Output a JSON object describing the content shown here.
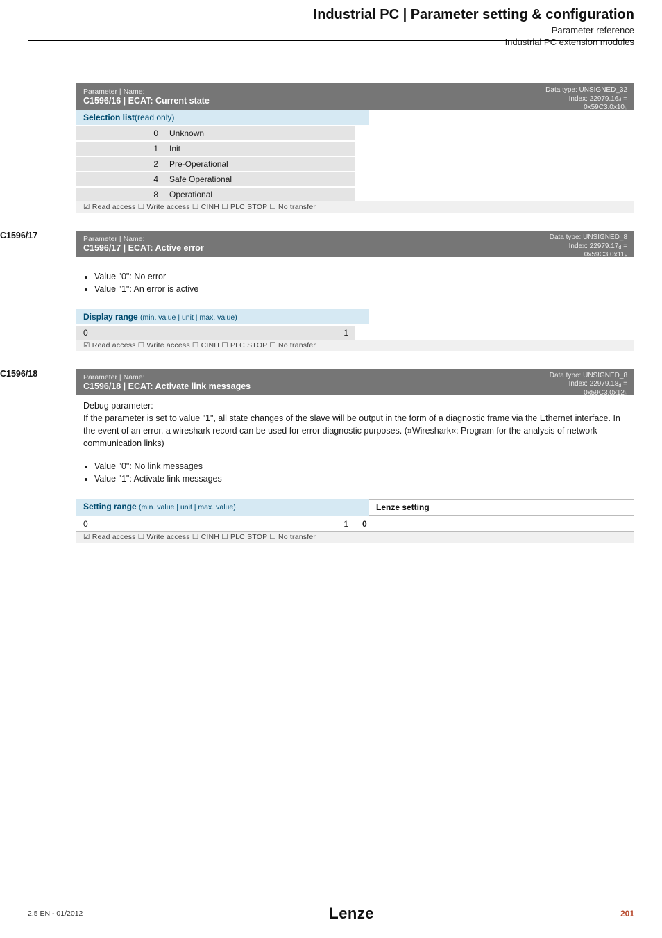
{
  "header": {
    "title": "Industrial PC | Parameter setting & configuration",
    "sub1": "Parameter reference",
    "sub2": "Industrial PC extension modules"
  },
  "labels": {
    "pn": "Parameter | Name:",
    "sel_list": "Selection list",
    "read_only": "(read only)",
    "display_range": "Display range",
    "setting_range": "Setting range",
    "range_suffix": "(min. value | unit | max. value)",
    "lenze_setting": "Lenze setting",
    "access": "☑ Read access  ☐ Write access  ☐ CINH  ☐ PLC STOP  ☐ No transfer"
  },
  "p1": {
    "name": "C1596/16 | ECAT: Current state",
    "dt1": "Data type: UNSIGNED_32",
    "dt2": "Index: 22979.16",
    "dt2sub": "d",
    "dt2eq": " =",
    "dt3": "0x59C3.0x10",
    "dt3sub": "h",
    "rows": [
      {
        "n": "0",
        "t": "Unknown"
      },
      {
        "n": "1",
        "t": "Init"
      },
      {
        "n": "2",
        "t": "Pre-Operational"
      },
      {
        "n": "4",
        "t": "Safe Operational"
      },
      {
        "n": "8",
        "t": "Operational"
      }
    ]
  },
  "p2": {
    "label": "C1596/17",
    "name": "C1596/17 | ECAT: Active error",
    "dt1": "Data type: UNSIGNED_8",
    "dt2": "Index: 22979.17",
    "dt2sub": "d",
    "dt2eq": " =",
    "dt3": "0x59C3.0x11",
    "dt3sub": "h",
    "bullets": [
      "Value \"0\": No error",
      "Value \"1\": An error is active"
    ],
    "range_min": "0",
    "range_max": "1"
  },
  "p3": {
    "label": "C1596/18",
    "name": "C1596/18 | ECAT: Activate link messages",
    "dt1": "Data type: UNSIGNED_8",
    "dt2": "Index: 22979.18",
    "dt2sub": "d",
    "dt2eq": " =",
    "dt3": "0x59C3.0x12",
    "dt3sub": "h",
    "desc_head": "Debug parameter:",
    "desc_body": "If the parameter is set to value \"1\", all state changes of the slave will be output in the form of a diagnostic frame via the Ethernet interface. In the event of an error, a wireshark record can be used for error diagnostic purposes. (»Wireshark«: Program for the analysis of network communication links)",
    "bullets": [
      "Value \"0\": No link messages",
      "Value \"1\": Activate link messages"
    ],
    "range_min": "0",
    "range_max": "1",
    "default": "0"
  },
  "footer": {
    "note": "2.5 EN - 01/2012",
    "logo": "Lenze",
    "page": "201"
  }
}
